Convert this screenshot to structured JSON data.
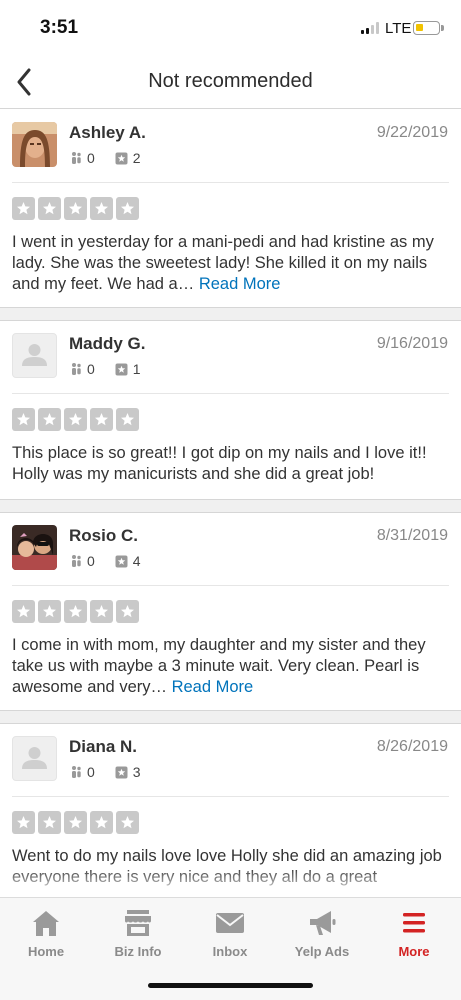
{
  "status": {
    "time": "3:51",
    "network": "LTE"
  },
  "nav": {
    "title": "Not recommended"
  },
  "reviews": [
    {
      "name": "Ashley A.",
      "date": "9/22/2019",
      "friends": "0",
      "reviews": "2",
      "rating": 5,
      "text": "I went in yesterday for a mani-pedi and had kristine as my lady. She was the sweetest lady! She killed it on my nails and my feet. We had a…",
      "more": "Read More"
    },
    {
      "name": "Maddy G.",
      "date": "9/16/2019",
      "friends": "0",
      "reviews": "1",
      "rating": 5,
      "text": "This place is so great!! I got dip on my nails and I love it!! Holly was my manicurists and she did a great job!",
      "more": ""
    },
    {
      "name": "Rosio C.",
      "date": "8/31/2019",
      "friends": "0",
      "reviews": "4",
      "rating": 5,
      "text": "I come in with mom, my daughter and my sister and they take us with maybe a 3 minute wait. Very clean. Pearl is awesome and very…",
      "more": "Read More"
    },
    {
      "name": "Diana N.",
      "date": "8/26/2019",
      "friends": "0",
      "reviews": "3",
      "rating": 5,
      "text": "Went to do my nails love love Holly she did an amazing job everyone there is very nice and they all do a great",
      "more": ""
    }
  ],
  "tabs": [
    {
      "label": "Home",
      "icon": "home-icon"
    },
    {
      "label": "Biz Info",
      "icon": "store-icon"
    },
    {
      "label": "Inbox",
      "icon": "mail-icon"
    },
    {
      "label": "Yelp Ads",
      "icon": "megaphone-icon"
    },
    {
      "label": "More",
      "icon": "menu-icon"
    }
  ],
  "colors": {
    "accent": "#d32323",
    "link": "#0073bb",
    "star_empty": "#c9c9c9"
  }
}
